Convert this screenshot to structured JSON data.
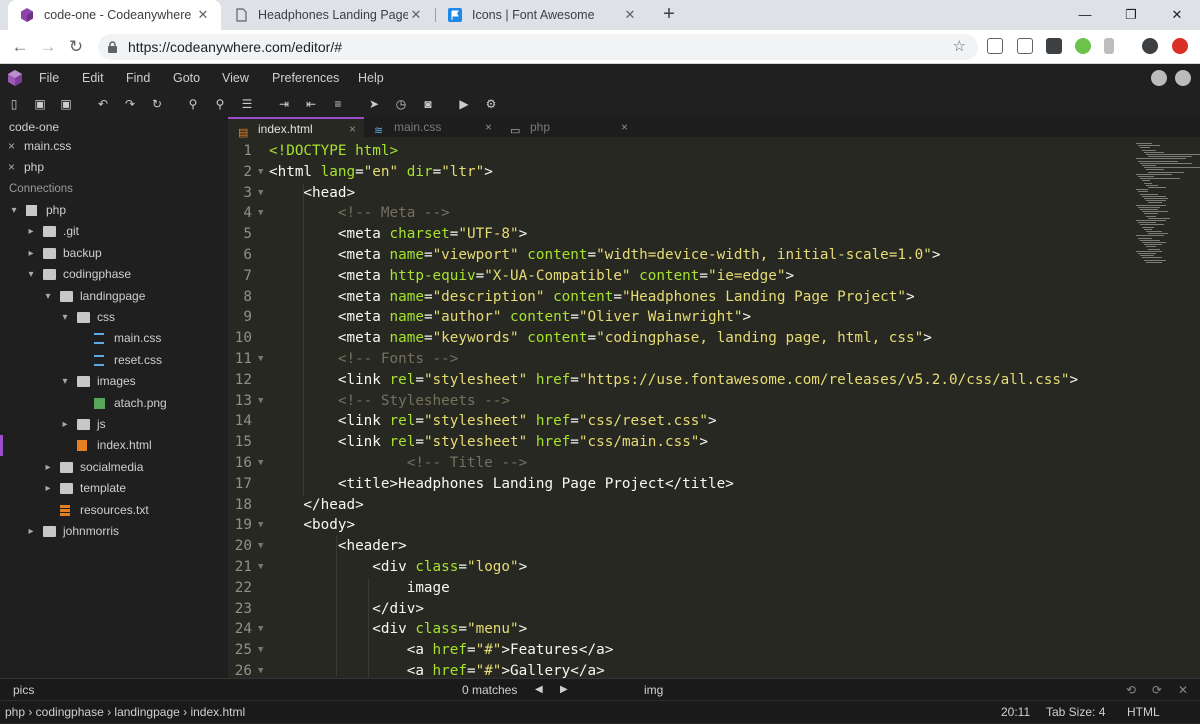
{
  "browser": {
    "tabs": [
      {
        "title": "code-one - Codeanywhere",
        "active": true
      },
      {
        "title": "Headphones Landing Page Projec",
        "active": false
      },
      {
        "title": "Icons | Font Awesome",
        "active": false
      }
    ],
    "new_tab": "+",
    "window_controls": {
      "minimize": "—",
      "maximize": "❐",
      "close": "✕"
    },
    "nav": {
      "back": "←",
      "forward": "→",
      "reload": "↻"
    },
    "url": "https://codeanywhere.com/editor/#",
    "bookmark_star": "☆",
    "tab_close": "✕"
  },
  "menu": [
    "File",
    "Edit",
    "Find",
    "Goto",
    "View",
    "Preferences",
    "Help"
  ],
  "sidebar": {
    "project": "code-one",
    "open_files": [
      {
        "close": "×",
        "name": "main.css"
      },
      {
        "close": "×",
        "name": "php"
      }
    ],
    "connections_label": "Connections",
    "tree": [
      {
        "label": "php",
        "arrow": "▾",
        "type": "server"
      },
      {
        "label": ".git",
        "arrow": "▸",
        "type": "folder"
      },
      {
        "label": "backup",
        "arrow": "▸",
        "type": "folder"
      },
      {
        "label": "codingphase",
        "arrow": "▾",
        "type": "folder"
      },
      {
        "label": "landingpage",
        "arrow": "▾",
        "type": "folder"
      },
      {
        "label": "css",
        "arrow": "▾",
        "type": "folder"
      },
      {
        "label": "main.css",
        "arrow": "",
        "type": "css"
      },
      {
        "label": "reset.css",
        "arrow": "",
        "type": "css"
      },
      {
        "label": "images",
        "arrow": "▾",
        "type": "folder"
      },
      {
        "label": "atach.png",
        "arrow": "",
        "type": "image"
      },
      {
        "label": "js",
        "arrow": "▸",
        "type": "folder"
      },
      {
        "label": "index.html",
        "arrow": "",
        "type": "html"
      },
      {
        "label": "socialmedia",
        "arrow": "▸",
        "type": "folder"
      },
      {
        "label": "template",
        "arrow": "▸",
        "type": "folder"
      },
      {
        "label": "resources.txt",
        "arrow": "",
        "type": "text"
      },
      {
        "label": "johnmorris",
        "arrow": "▸",
        "type": "folder"
      }
    ]
  },
  "editor_tabs": [
    {
      "label": "index.html",
      "close": "×",
      "active": true
    },
    {
      "label": "main.css",
      "close": "×",
      "active": false
    },
    {
      "label": "php",
      "close": "×",
      "active": false
    }
  ],
  "code_lines": [
    {
      "n": "1",
      "segs": [
        [
          "doc",
          "<!DOCTYPE html>"
        ]
      ]
    },
    {
      "n": "2",
      "segs": [
        [
          "tag",
          "<html "
        ],
        [
          "attr",
          "lang"
        ],
        [
          "tag",
          "="
        ],
        [
          "str",
          "\"en\""
        ],
        [
          "tag",
          " "
        ],
        [
          "attr",
          "dir"
        ],
        [
          "tag",
          "="
        ],
        [
          "str",
          "\"ltr\""
        ],
        [
          "tag",
          ">"
        ]
      ]
    },
    {
      "n": "3",
      "segs": [
        [
          "tag",
          "    <head>"
        ]
      ]
    },
    {
      "n": "4",
      "segs": [
        [
          "com",
          "        <!-- Meta -->"
        ]
      ]
    },
    {
      "n": "5",
      "segs": [
        [
          "tag",
          "        <meta "
        ],
        [
          "attr",
          "charset"
        ],
        [
          "tag",
          "="
        ],
        [
          "str",
          "\"UTF-8\""
        ],
        [
          "tag",
          ">"
        ]
      ]
    },
    {
      "n": "6",
      "segs": [
        [
          "tag",
          "        <meta "
        ],
        [
          "attr",
          "name"
        ],
        [
          "tag",
          "="
        ],
        [
          "str",
          "\"viewport\""
        ],
        [
          "tag",
          " "
        ],
        [
          "attr",
          "content"
        ],
        [
          "tag",
          "="
        ],
        [
          "str",
          "\"width=device-width, initial-scale=1.0\""
        ],
        [
          "tag",
          ">"
        ]
      ]
    },
    {
      "n": "7",
      "segs": [
        [
          "tag",
          "        <meta "
        ],
        [
          "attr",
          "http-equiv"
        ],
        [
          "tag",
          "="
        ],
        [
          "str",
          "\"X-UA-Compatible\""
        ],
        [
          "tag",
          " "
        ],
        [
          "attr",
          "content"
        ],
        [
          "tag",
          "="
        ],
        [
          "str",
          "\"ie=edge\""
        ],
        [
          "tag",
          ">"
        ]
      ]
    },
    {
      "n": "8",
      "segs": [
        [
          "tag",
          "        <meta "
        ],
        [
          "attr",
          "name"
        ],
        [
          "tag",
          "="
        ],
        [
          "str",
          "\"description\""
        ],
        [
          "tag",
          " "
        ],
        [
          "attr",
          "content"
        ],
        [
          "tag",
          "="
        ],
        [
          "str",
          "\"Headphones Landing Page Project\""
        ],
        [
          "tag",
          ">"
        ]
      ]
    },
    {
      "n": "9",
      "segs": [
        [
          "tag",
          "        <meta "
        ],
        [
          "attr",
          "name"
        ],
        [
          "tag",
          "="
        ],
        [
          "str",
          "\"author\""
        ],
        [
          "tag",
          " "
        ],
        [
          "attr",
          "content"
        ],
        [
          "tag",
          "="
        ],
        [
          "str",
          "\"Oliver Wainwright\""
        ],
        [
          "tag",
          ">"
        ]
      ]
    },
    {
      "n": "10",
      "segs": [
        [
          "tag",
          "        <meta "
        ],
        [
          "attr",
          "name"
        ],
        [
          "tag",
          "="
        ],
        [
          "str",
          "\"keywords\""
        ],
        [
          "tag",
          " "
        ],
        [
          "attr",
          "content"
        ],
        [
          "tag",
          "="
        ],
        [
          "str",
          "\"codingphase, landing page, html, css\""
        ],
        [
          "tag",
          ">"
        ]
      ]
    },
    {
      "n": "11",
      "segs": [
        [
          "com",
          "        <!-- Fonts -->"
        ]
      ]
    },
    {
      "n": "12",
      "segs": [
        [
          "tag",
          "        <link "
        ],
        [
          "attr",
          "rel"
        ],
        [
          "tag",
          "="
        ],
        [
          "str",
          "\"stylesheet\""
        ],
        [
          "tag",
          " "
        ],
        [
          "attr",
          "href"
        ],
        [
          "tag",
          "="
        ],
        [
          "str",
          "\"https://use.fontawesome.com/releases/v5.2.0/css/all.css\""
        ],
        [
          "tag",
          ">"
        ]
      ]
    },
    {
      "n": "13",
      "segs": [
        [
          "com",
          "        <!-- Stylesheets -->"
        ]
      ]
    },
    {
      "n": "14",
      "segs": [
        [
          "tag",
          "        <link "
        ],
        [
          "attr",
          "rel"
        ],
        [
          "tag",
          "="
        ],
        [
          "str",
          "\"stylesheet\""
        ],
        [
          "tag",
          " "
        ],
        [
          "attr",
          "href"
        ],
        [
          "tag",
          "="
        ],
        [
          "str",
          "\"css/reset.css\""
        ],
        [
          "tag",
          ">"
        ]
      ]
    },
    {
      "n": "15",
      "segs": [
        [
          "tag",
          "        <link "
        ],
        [
          "attr",
          "rel"
        ],
        [
          "tag",
          "="
        ],
        [
          "str",
          "\"stylesheet\""
        ],
        [
          "tag",
          " "
        ],
        [
          "attr",
          "href"
        ],
        [
          "tag",
          "="
        ],
        [
          "str",
          "\"css/main.css\""
        ],
        [
          "tag",
          ">"
        ]
      ]
    },
    {
      "n": "16",
      "segs": [
        [
          "com",
          "                <!-- Title -->"
        ]
      ]
    },
    {
      "n": "17",
      "segs": [
        [
          "tag",
          "        <title>Headphones Landing Page Project</title>"
        ]
      ]
    },
    {
      "n": "18",
      "segs": [
        [
          "tag",
          "    </head>"
        ]
      ]
    },
    {
      "n": "19",
      "segs": [
        [
          "tag",
          "    <body>"
        ]
      ]
    },
    {
      "n": "20",
      "segs": [
        [
          "tag",
          "        <header>"
        ]
      ]
    },
    {
      "n": "21",
      "segs": [
        [
          "tag",
          "            <div "
        ],
        [
          "attr",
          "class"
        ],
        [
          "tag",
          "="
        ],
        [
          "str",
          "\"logo\""
        ],
        [
          "tag",
          ">"
        ]
      ]
    },
    {
      "n": "22",
      "segs": [
        [
          "tag",
          "                image"
        ]
      ]
    },
    {
      "n": "23",
      "segs": [
        [
          "tag",
          "            </div>"
        ]
      ]
    },
    {
      "n": "24",
      "segs": [
        [
          "tag",
          "            <div "
        ],
        [
          "attr",
          "class"
        ],
        [
          "tag",
          "="
        ],
        [
          "str",
          "\"menu\""
        ],
        [
          "tag",
          ">"
        ]
      ]
    },
    {
      "n": "25",
      "segs": [
        [
          "tag",
          "                <a "
        ],
        [
          "attr",
          "href"
        ],
        [
          "tag",
          "="
        ],
        [
          "str",
          "\"#\""
        ],
        [
          "tag",
          ">Features</a>"
        ]
      ]
    },
    {
      "n": "26",
      "segs": [
        [
          "tag",
          "                <a "
        ],
        [
          "attr",
          "href"
        ],
        [
          "tag",
          "="
        ],
        [
          "str",
          "\"#\""
        ],
        [
          "tag",
          ">Gallery</a>"
        ]
      ]
    }
  ],
  "folded_lines": [
    "2",
    "3",
    "4",
    "11",
    "13",
    "16",
    "19",
    "20",
    "21",
    "24",
    "25",
    "26"
  ],
  "find": {
    "query": "pics",
    "matches": "0 matches",
    "prev": "◀",
    "next": "▶",
    "replace": "img"
  },
  "status": {
    "breadcrumb": "php › codingphase › landingpage › index.html",
    "cursor": "20:11",
    "tab_size": "Tab Size: 4",
    "language": "HTML"
  },
  "colors": {
    "accent": "#9b4dca",
    "editor_bg": "#272822",
    "attr": "#a6e22e",
    "string": "#e6db74",
    "comment": "#75715e"
  }
}
